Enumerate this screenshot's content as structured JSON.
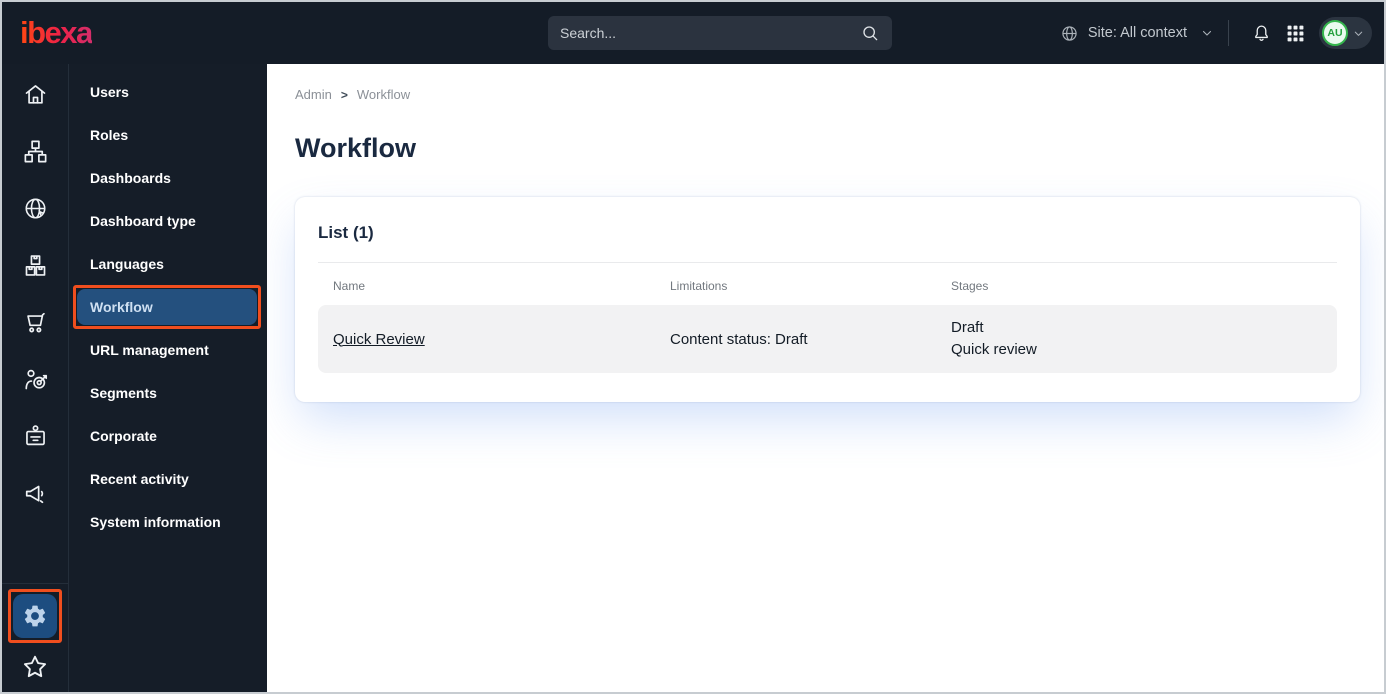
{
  "topbar": {
    "logo_text": "ibexa",
    "search_placeholder": "Search...",
    "site_context_label": "Site: All context",
    "avatar_initials": "AU"
  },
  "iconrail": {
    "items": [
      "home-icon",
      "content-tree-icon",
      "site-globe-icon",
      "product-catalog-icon",
      "cart-icon",
      "audience-target-icon",
      "id-badge-icon",
      "megaphone-icon"
    ],
    "bottom": [
      "settings-gear-icon",
      "favorites-star-icon"
    ],
    "selected": "settings-gear-icon"
  },
  "sidebar": {
    "items": [
      "Users",
      "Roles",
      "Dashboards",
      "Dashboard type",
      "Languages",
      "Workflow",
      "URL management",
      "Segments",
      "Corporate",
      "Recent activity",
      "System information"
    ],
    "selected": "Workflow"
  },
  "breadcrumb": {
    "items": [
      "Admin",
      "Workflow"
    ],
    "separator": ">"
  },
  "page": {
    "title": "Workflow"
  },
  "card": {
    "title": "List (1)",
    "table": {
      "headers": [
        "Name",
        "Limitations",
        "Stages"
      ],
      "rows": [
        {
          "name": "Quick Review",
          "limitations": "Content status: Draft",
          "stages": [
            "Draft",
            "Quick review"
          ]
        }
      ]
    }
  },
  "colors": {
    "topbar_bg": "#141c27",
    "selected_menu_bg": "#24507e",
    "annotation_outline": "#f04e1e",
    "avatar_green": "#35b54d",
    "logo_gradient_start": "#ff4713",
    "logo_gradient_end": "#d42e6b",
    "card_glow": "rgba(100,150,240,0.30)"
  }
}
